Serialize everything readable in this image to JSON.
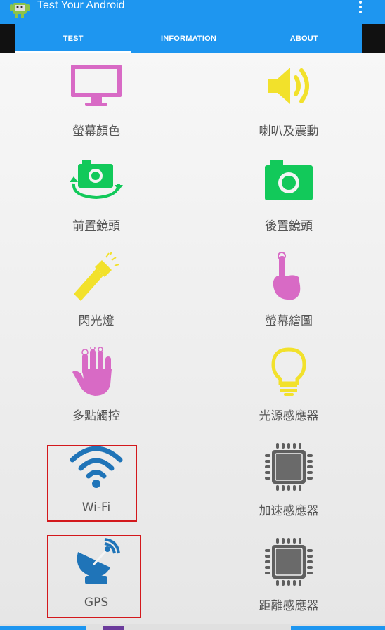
{
  "app": {
    "title": "Test Your Android",
    "icon": "android-robot-icon",
    "menu_icon": "overflow-menu-icon"
  },
  "tabs": [
    {
      "label": "TEST",
      "active": true
    },
    {
      "label": "INFORMATION",
      "active": false
    },
    {
      "label": "ABOUT",
      "active": false
    }
  ],
  "colors": {
    "primary": "#1e96f0",
    "pink": "#d86ac5",
    "yellow": "#f2e12b",
    "green": "#12c95a",
    "blue": "#1f74b8",
    "gray": "#5f5f5f",
    "highlight": "#d3181c"
  },
  "tests": [
    {
      "label": "螢幕顏色",
      "icon": "monitor-icon"
    },
    {
      "label": "喇叭及震動",
      "icon": "speaker-icon"
    },
    {
      "label": "前置鏡頭",
      "icon": "front-camera-icon"
    },
    {
      "label": "後置鏡頭",
      "icon": "rear-camera-icon"
    },
    {
      "label": "閃光燈",
      "icon": "flashlight-icon"
    },
    {
      "label": "螢幕繪圖",
      "icon": "finger-touch-icon"
    },
    {
      "label": "多點觸控",
      "icon": "multi-touch-hand-icon"
    },
    {
      "label": "光源感應器",
      "icon": "light-bulb-icon"
    },
    {
      "label": "Wi-Fi",
      "icon": "wifi-icon",
      "highlighted": true
    },
    {
      "label": "加速感應器",
      "icon": "chip-icon"
    },
    {
      "label": "GPS",
      "icon": "satellite-dish-icon",
      "highlighted": true
    },
    {
      "label": "距離感應器",
      "icon": "chip-icon"
    }
  ]
}
